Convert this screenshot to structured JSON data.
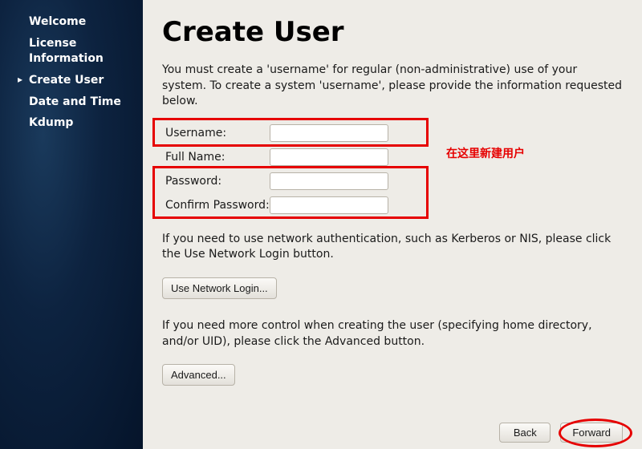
{
  "sidebar": {
    "items": [
      {
        "label": "Welcome"
      },
      {
        "label": "License Information"
      },
      {
        "label": "Create User"
      },
      {
        "label": "Date and Time"
      },
      {
        "label": "Kdump"
      }
    ]
  },
  "page": {
    "title": "Create User",
    "intro": "You must create a 'username' for regular (non-administrative) use of your system.  To create a system 'username', please provide the information requested below.",
    "form": {
      "username_label": "Username:",
      "username_value": "",
      "fullname_label": "Full Name:",
      "fullname_value": "",
      "password_label": "Password:",
      "password_value": "",
      "confirm_label": "Confirm Password:",
      "confirm_value": ""
    },
    "annotation_text": "在这里新建用户",
    "netauth_text": "If you need to use network authentication, such as Kerberos or NIS, please click the Use Network Login button.",
    "netauth_button": "Use Network Login...",
    "advanced_text": "If you need more control when creating the user (specifying home directory, and/or UID), please click the Advanced button.",
    "advanced_button": "Advanced..."
  },
  "footer": {
    "back": "Back",
    "forward": "Forward"
  },
  "colors": {
    "highlight": "#e60000"
  }
}
